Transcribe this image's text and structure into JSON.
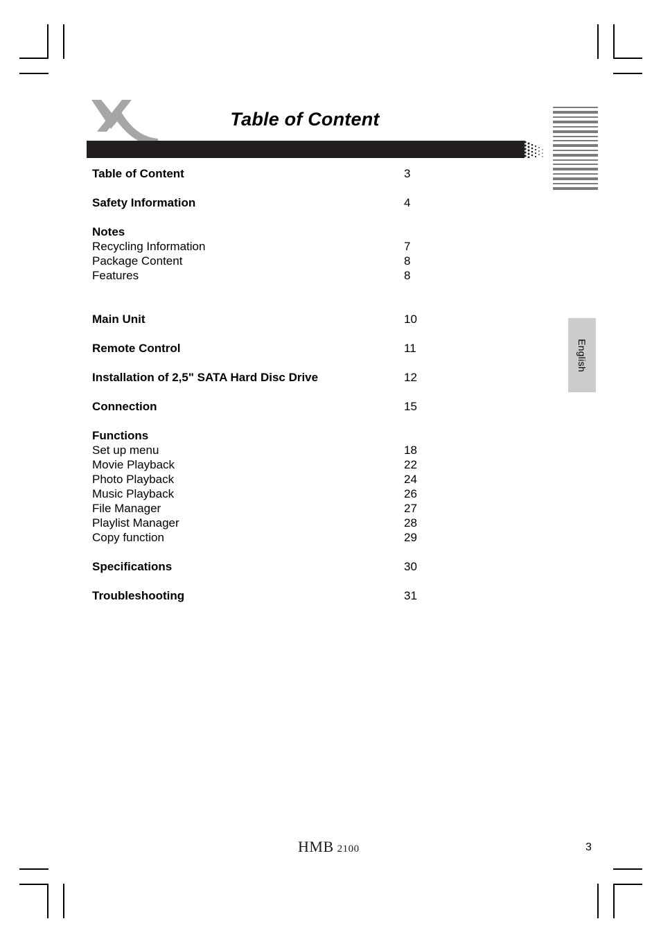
{
  "document": {
    "title": "Table of Content",
    "page_number": "3",
    "language_tab": "English",
    "footer_logo_brand": "HMB",
    "footer_logo_model": "2100",
    "logo_icon": "x-swoosh-logo"
  },
  "colors": {
    "header_bar": "#231f1e",
    "logo_gray": "#a6a6a6",
    "stripe_gray": "#7b7b7b",
    "tab_gray": "#cccccc",
    "text": "#000000"
  },
  "toc": {
    "entries": [
      {
        "label": "Table of Content",
        "page": "3",
        "level": "major",
        "space_before": "none"
      },
      {
        "label": "Safety Information",
        "page": "4",
        "level": "major",
        "space_before": "large"
      },
      {
        "label": "Notes",
        "page": "",
        "level": "major",
        "space_before": "large"
      },
      {
        "label": "Recycling Information",
        "page": "7",
        "level": "sub",
        "space_before": "none"
      },
      {
        "label": "Package Content",
        "page": "8",
        "level": "sub",
        "space_before": "none"
      },
      {
        "label": "Features",
        "page": "8",
        "level": "sub",
        "space_before": "none"
      },
      {
        "label": "Main Unit",
        "page": "10",
        "level": "major",
        "space_before": "xlarge"
      },
      {
        "label": "Remote Control",
        "page": "11",
        "level": "major",
        "space_before": "large"
      },
      {
        "label": "Installation of 2,5\" SATA Hard Disc Drive",
        "page": "12",
        "level": "major",
        "space_before": "large"
      },
      {
        "label": "Connection",
        "page": "15",
        "level": "major",
        "space_before": "large"
      },
      {
        "label": "Functions",
        "page": "",
        "level": "major",
        "space_before": "large"
      },
      {
        "label": "Set up menu",
        "page": "18",
        "level": "sub",
        "space_before": "none"
      },
      {
        "label": "Movie Playback",
        "page": "22",
        "level": "sub",
        "space_before": "none"
      },
      {
        "label": "Photo Playback",
        "page": "24",
        "level": "sub",
        "space_before": "none"
      },
      {
        "label": "Music Playback",
        "page": "26",
        "level": "sub",
        "space_before": "none"
      },
      {
        "label": "File Manager",
        "page": "27",
        "level": "sub",
        "space_before": "none"
      },
      {
        "label": "Playlist Manager",
        "page": "28",
        "level": "sub",
        "space_before": "none"
      },
      {
        "label": "Copy function",
        "page": "29",
        "level": "sub",
        "space_before": "none"
      },
      {
        "label": "Specifications",
        "page": "30",
        "level": "major",
        "space_before": "large"
      },
      {
        "label": "Troubleshooting",
        "page": "31",
        "level": "major",
        "space_before": "large"
      }
    ]
  }
}
